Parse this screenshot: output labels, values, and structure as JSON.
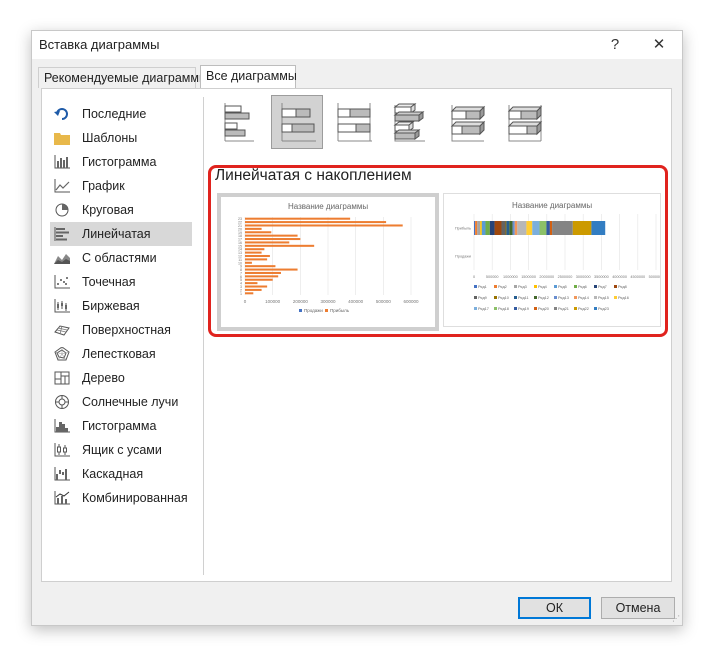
{
  "window": {
    "title": "Вставка диаграммы",
    "help_icon": "?",
    "close_icon": "✕"
  },
  "tabs": [
    {
      "label": "Рекомендуемые диаграммы",
      "active": false
    },
    {
      "label": "Все диаграммы",
      "active": true
    }
  ],
  "sidebar": {
    "items": [
      {
        "label": "Последние",
        "icon": "recent-icon"
      },
      {
        "label": "Шаблоны",
        "icon": "folder-icon"
      },
      {
        "label": "Гистограмма",
        "icon": "column-chart-icon"
      },
      {
        "label": "График",
        "icon": "line-chart-icon"
      },
      {
        "label": "Круговая",
        "icon": "pie-chart-icon"
      },
      {
        "label": "Линейчатая",
        "icon": "bar-chart-icon",
        "selected": true
      },
      {
        "label": "С областями",
        "icon": "area-chart-icon"
      },
      {
        "label": "Точечная",
        "icon": "scatter-chart-icon"
      },
      {
        "label": "Биржевая",
        "icon": "stock-chart-icon"
      },
      {
        "label": "Поверхностная",
        "icon": "surface-chart-icon"
      },
      {
        "label": "Лепестковая",
        "icon": "radar-chart-icon"
      },
      {
        "label": "Дерево",
        "icon": "treemap-icon"
      },
      {
        "label": "Солнечные лучи",
        "icon": "sunburst-icon"
      },
      {
        "label": "Гистограмма",
        "icon": "histogram-icon"
      },
      {
        "label": "Ящик с усами",
        "icon": "box-whisker-icon"
      },
      {
        "label": "Каскадная",
        "icon": "waterfall-icon"
      },
      {
        "label": "Комбинированная",
        "icon": "combo-chart-icon"
      }
    ]
  },
  "subtypes": [
    {
      "icon": "clustered-bar-icon",
      "selected": false
    },
    {
      "icon": "stacked-bar-icon",
      "selected": true
    },
    {
      "icon": "100-stacked-bar-icon",
      "selected": false
    },
    {
      "icon": "3d-clustered-bar-icon",
      "selected": false
    },
    {
      "icon": "3d-stacked-bar-icon",
      "selected": false
    },
    {
      "icon": "3d-100-stacked-bar-icon",
      "selected": false
    }
  ],
  "selected_subtype_title": "Линейчатая с накоплением",
  "previews": [
    {
      "title": "Название диаграммы",
      "chart_data": {
        "type": "bar",
        "stacked": true,
        "orientation": "horizontal",
        "categories": [
          "1",
          "2",
          "3",
          "4",
          "5",
          "6",
          "7",
          "8",
          "9",
          "10",
          "11",
          "12",
          "13",
          "14",
          "15",
          "16",
          "17",
          "18",
          "19",
          "20",
          "21",
          "22",
          "23"
        ],
        "category_labels_visible": [
          "1",
          "2",
          "3",
          "4",
          "5",
          "6",
          "7",
          "8",
          "9",
          "10",
          "11",
          "12",
          "13",
          "14",
          "15",
          "16",
          "17",
          "18",
          "19",
          "20",
          "21",
          "22",
          "23"
        ],
        "series": [
          {
            "name": "Продажи",
            "values": [
              0,
              0,
              0,
              0,
              0,
              0,
              0,
              0,
              0,
              0,
              0,
              0,
              0,
              0,
              0,
              0,
              0,
              0,
              0,
              0,
              0,
              0,
              0
            ],
            "color": "#4472c4"
          },
          {
            "name": "Прибыль",
            "values": [
              30000,
              60000,
              80000,
              45000,
              100000,
              120000,
              130000,
              190000,
              110000,
              25000,
              80000,
              90000,
              60000,
              70000,
              250000,
              160000,
              200000,
              190000,
              95000,
              60000,
              570000,
              510000,
              380000
            ],
            "color": "#ed7d31"
          }
        ],
        "xlim": [
          0,
          600000
        ],
        "xticks": [
          "0",
          "100000",
          "200000",
          "300000",
          "400000",
          "500000",
          "600000"
        ],
        "legend": "bottom"
      }
    },
    {
      "title": "Название диаграммы",
      "chart_data": {
        "type": "bar",
        "stacked": true,
        "orientation": "horizontal",
        "categories": [
          "Продажи",
          "Прибыль"
        ],
        "xlim": [
          0,
          5000000
        ],
        "xticks": [
          "0",
          "500000",
          "1000000",
          "1500000",
          "2000000",
          "2500000",
          "3000000",
          "3500000",
          "4000000",
          "4500000",
          "5000000"
        ],
        "legend": "bottom",
        "legend_entries": [
          "Ряд1",
          "Ряд2",
          "Ряд3",
          "Ряд4",
          "Ряд5",
          "Ряд6",
          "Ряд7",
          "Ряд8",
          "Ряд9",
          "Ряд10",
          "Ряд11",
          "Ряд12",
          "Ряд13",
          "Ряд14",
          "Ряд15",
          "Ряд16",
          "Ряд17",
          "Ряд18",
          "Ряд19",
          "Ряд20",
          "Ряд21",
          "Ряд22",
          "Ряд23"
        ],
        "series_colors": [
          "#4472c4",
          "#ed7d31",
          "#a5a5a5",
          "#ffc000",
          "#5b9bd5",
          "#70ad47",
          "#264478",
          "#9e480e",
          "#636363",
          "#997300",
          "#255e91",
          "#43682b",
          "#698ed0",
          "#f1975a",
          "#b7b7b7",
          "#ffcd33",
          "#7cafdd",
          "#8cc168",
          "#335aa1",
          "#d26012",
          "#848484",
          "#cc9a00",
          "#327dc2"
        ],
        "row_values": [
          [
            0,
            0,
            0,
            0,
            0,
            0,
            0,
            0,
            0,
            0,
            0,
            0,
            0,
            0,
            0,
            0,
            0,
            0,
            0,
            0,
            0,
            0,
            0
          ],
          [
            30000,
            60000,
            80000,
            45000,
            100000,
            120000,
            130000,
            190000,
            110000,
            25000,
            80000,
            90000,
            60000,
            70000,
            250000,
            160000,
            200000,
            190000,
            95000,
            60000,
            570000,
            510000,
            380000
          ]
        ]
      }
    }
  ],
  "buttons": {
    "ok": "ОК",
    "cancel": "Отмена"
  }
}
